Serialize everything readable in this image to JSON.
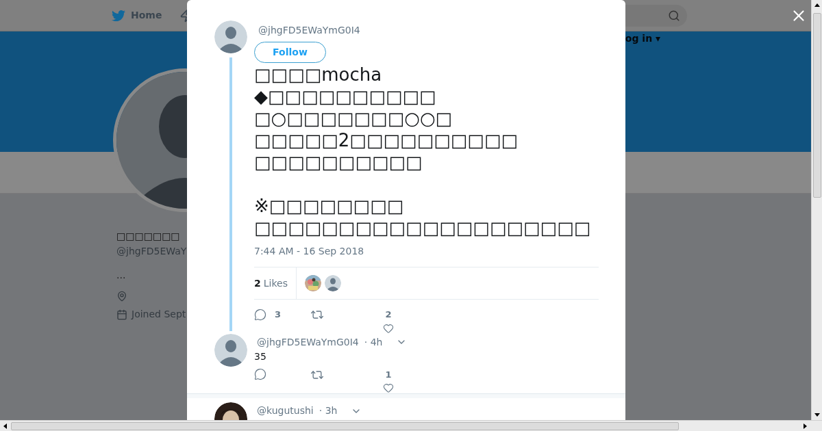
{
  "nav": {
    "home": "Home",
    "login": "og in ▾"
  },
  "profile": {
    "name": "□□□□□□□",
    "handle": "@jhgFD5EWaY",
    "bio": "...",
    "joined": "Joined Sept"
  },
  "tweet": {
    "handle": "@jhgFD5EWaYmG0I4",
    "follow": "Follow",
    "text": "□□□□mocha\n◆□□□□□□□□□□\n□○□□□□□□□○○□\n□□□□□2□□□□□□□□□□\n□□□□□□□□□□\n\n※□□□□□□□□\n□□□□□□□□□□□□□□□□□□□□",
    "time": "7:44 AM - 16 Sep 2018",
    "likes_count": "2",
    "likes_label": "Likes",
    "likers": [
      {
        "kind": "picture"
      },
      {
        "kind": "default"
      }
    ],
    "reply_count": "3",
    "like_count": "2"
  },
  "replies": [
    {
      "avatar": {
        "kind": "default"
      },
      "handle": "@jhgFD5EWaYmG0I4",
      "age": "· 4h",
      "text": "35",
      "like_count": "1"
    },
    {
      "avatar": {
        "kind": "picture"
      },
      "handle": "@kugutushi",
      "age": "· 3h"
    }
  ]
}
